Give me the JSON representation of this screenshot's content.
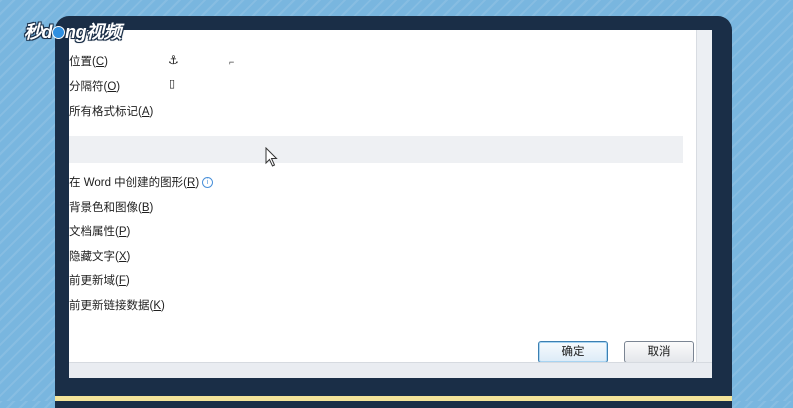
{
  "watermark": {
    "part1": "秒d",
    "part2": "ng视频"
  },
  "options": [
    {
      "label": "位置(",
      "key": "C",
      "end": ")",
      "symbol": "⚓"
    },
    {
      "label": "分隔符(",
      "key": "O",
      "end": ")",
      "symbol": "▯"
    },
    {
      "label": "所有格式标记(",
      "key": "A",
      "end": ")"
    }
  ],
  "print_options": [
    {
      "label": "在 Word 中创建的图形(",
      "key": "R",
      "end": ")"
    },
    {
      "label": "背景色和图像(",
      "key": "B",
      "end": ")"
    },
    {
      "label": "文档属性(",
      "key": "P",
      "end": ")"
    },
    {
      "label": "隐藏文字(",
      "key": "X",
      "end": ")"
    },
    {
      "label": "前更新域(",
      "key": "F",
      "end": ")"
    },
    {
      "label": "前更新链接数据(",
      "key": "K",
      "end": ")"
    }
  ],
  "info_icon": "i",
  "buttons": {
    "ok": "确定",
    "cancel": "取消"
  },
  "icons": [
    "anchor-icon",
    "page-break-icon",
    "info-icon",
    "mouse-pointer-icon"
  ]
}
